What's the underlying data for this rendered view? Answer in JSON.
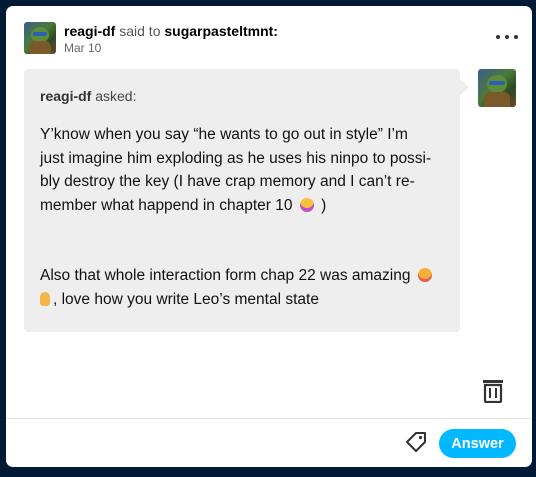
{
  "post": {
    "author": "reagi-df",
    "said_to_text": "said to",
    "recipient": "sugarpasteltmnt:",
    "date": "Mar 10"
  },
  "ask": {
    "asker": "reagi-df",
    "asked_text": "asked:",
    "paragraph1": {
      "line1": "Y’know when you say “he wants to go out in style” I’m",
      "line2": "just imagine him exploding as he uses his ninpo to possi-",
      "line3": "bly destroy the key (I have crap memory and I can’t re-",
      "line4_prefix": "member what happend in chapter 10",
      "line4_suffix": ")"
    },
    "paragraph2": {
      "line1": "Also that whole interaction form chap 22 was amazing",
      "line2_suffix": ", love how you write Leo’s mental state"
    }
  },
  "footer": {
    "answer_label": "Answer"
  },
  "colors": {
    "page_background": "#001935",
    "card": "#ffffff",
    "bubble": "#eeeeee",
    "answer_button": "#00b8ff"
  },
  "icons": {
    "menu": "more-dots-icon",
    "trash": "trash-icon",
    "tag": "tag-icon"
  }
}
